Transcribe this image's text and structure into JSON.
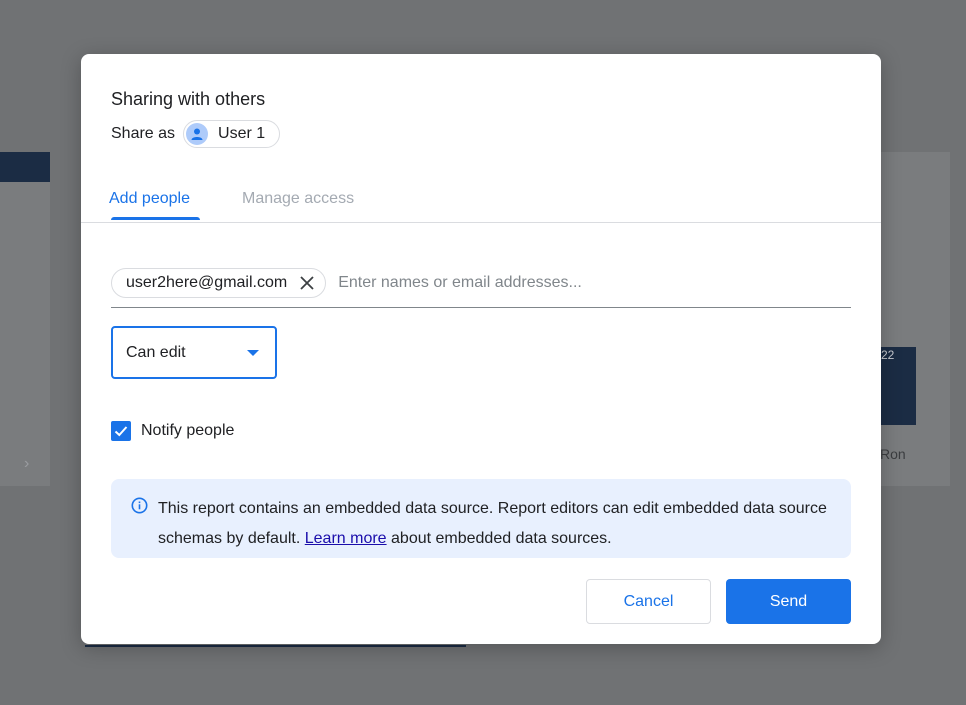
{
  "background": {
    "bar_label": "22",
    "axis_label": "Ron"
  },
  "dialog": {
    "title": "Sharing with others",
    "share_as_label": "Share as",
    "share_as_user": "User 1",
    "tabs": [
      {
        "label": "Add people",
        "active": true
      },
      {
        "label": "Manage access",
        "active": false
      }
    ],
    "people_chips": [
      "user2here@gmail.com"
    ],
    "people_input_placeholder": "Enter names or email addresses...",
    "role_value": "Can edit",
    "notify_label": "Notify people",
    "notify_checked": true,
    "info_text_before_link": "This report contains an embedded data source. Report editors can edit embedded data source schemas by default. ",
    "info_link": "Learn more",
    "info_text_after_link": " about embedded data sources.",
    "cancel_label": "Cancel",
    "send_label": "Send"
  },
  "colors": {
    "accent": "#1a73e8",
    "info_bg": "#e8f0fe",
    "overlay": "#707274"
  }
}
